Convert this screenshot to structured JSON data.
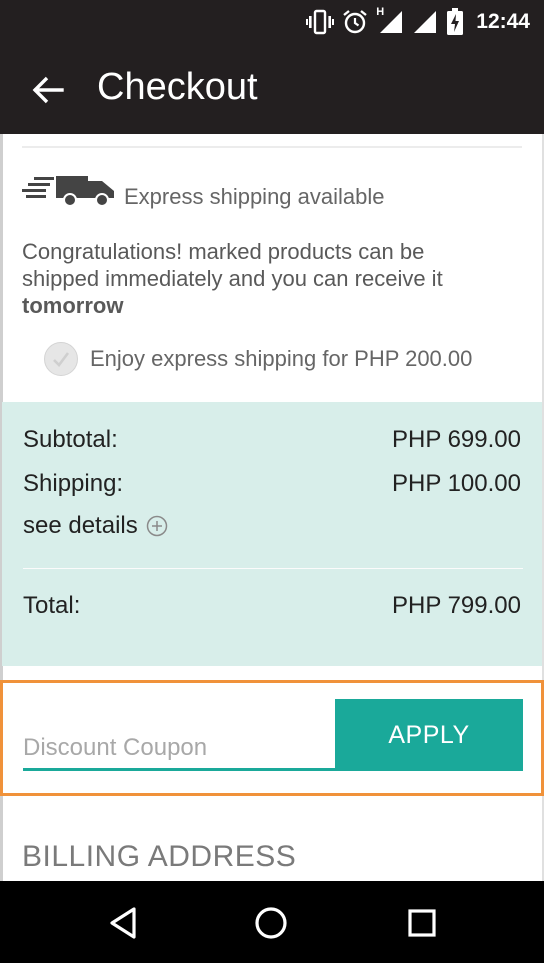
{
  "status_bar": {
    "time": "12:44",
    "network_badge": "H",
    "icons": [
      "vibrate-icon",
      "alarm-icon",
      "signal-icon",
      "signal-icon",
      "battery-charging-icon"
    ]
  },
  "app_bar": {
    "title": "Checkout",
    "back_icon": "arrow-back-icon"
  },
  "express": {
    "icon": "fast-truck-icon",
    "title": "Express shipping available",
    "message": "Congratulations! marked products can be shipped immediately and you can receive it",
    "message_bold": "tomorrow",
    "option_label": "Enjoy express shipping for PHP 200.00",
    "option_checked": false
  },
  "summary": {
    "subtotal_label": "Subtotal:",
    "subtotal_value": "PHP 699.00",
    "shipping_label": "Shipping:",
    "shipping_value": "PHP 100.00",
    "details_label": "see details",
    "total_label": "Total:",
    "total_value": "PHP 799.00"
  },
  "coupon": {
    "placeholder": "Discount Coupon",
    "value": "",
    "apply_label": "APPLY"
  },
  "billing": {
    "title": "BILLING ADDRESS"
  },
  "nav_bar": {
    "buttons": [
      "back-triangle-icon",
      "home-circle-icon",
      "recents-square-icon"
    ]
  },
  "colors": {
    "app_bar": "#231f20",
    "accent": "#1aa99a",
    "summary_bg": "#d8eeea",
    "highlight_border": "#f0923a"
  }
}
